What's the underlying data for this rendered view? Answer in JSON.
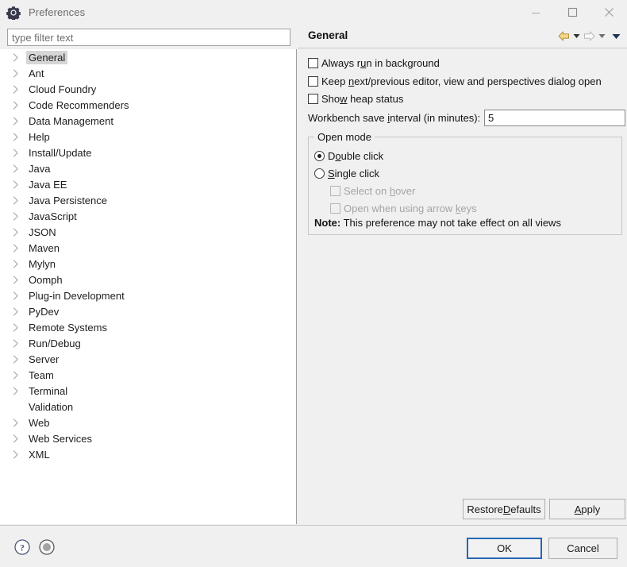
{
  "window": {
    "title": "Preferences",
    "icon": "gear-icon",
    "controls": {
      "minimize": "minimize-icon",
      "maximize": "maximize-icon",
      "close": "close-icon"
    }
  },
  "colors": {
    "dialog_bg": "#f0f0f0",
    "tree_bg": "#ffffff",
    "selection_bg": "#d6d6d6",
    "focus_border": "#2667b5",
    "back_arrow": "#ecc766",
    "help_icon": "#4a5a78"
  },
  "filter": {
    "value": "",
    "placeholder": "type filter text"
  },
  "tree": {
    "selected": "General",
    "items": [
      {
        "label": "General",
        "expandable": true,
        "selected": true
      },
      {
        "label": "Ant",
        "expandable": true,
        "selected": false
      },
      {
        "label": "Cloud Foundry",
        "expandable": true,
        "selected": false
      },
      {
        "label": "Code Recommenders",
        "expandable": true,
        "selected": false
      },
      {
        "label": "Data Management",
        "expandable": true,
        "selected": false
      },
      {
        "label": "Help",
        "expandable": true,
        "selected": false
      },
      {
        "label": "Install/Update",
        "expandable": true,
        "selected": false
      },
      {
        "label": "Java",
        "expandable": true,
        "selected": false
      },
      {
        "label": "Java EE",
        "expandable": true,
        "selected": false
      },
      {
        "label": "Java Persistence",
        "expandable": true,
        "selected": false
      },
      {
        "label": "JavaScript",
        "expandable": true,
        "selected": false
      },
      {
        "label": "JSON",
        "expandable": true,
        "selected": false
      },
      {
        "label": "Maven",
        "expandable": true,
        "selected": false
      },
      {
        "label": "Mylyn",
        "expandable": true,
        "selected": false
      },
      {
        "label": "Oomph",
        "expandable": true,
        "selected": false
      },
      {
        "label": "Plug-in Development",
        "expandable": true,
        "selected": false
      },
      {
        "label": "PyDev",
        "expandable": true,
        "selected": false
      },
      {
        "label": "Remote Systems",
        "expandable": true,
        "selected": false
      },
      {
        "label": "Run/Debug",
        "expandable": true,
        "selected": false
      },
      {
        "label": "Server",
        "expandable": true,
        "selected": false
      },
      {
        "label": "Team",
        "expandable": true,
        "selected": false
      },
      {
        "label": "Terminal",
        "expandable": true,
        "selected": false
      },
      {
        "label": "Validation",
        "expandable": false,
        "selected": false
      },
      {
        "label": "Web",
        "expandable": true,
        "selected": false
      },
      {
        "label": "Web Services",
        "expandable": true,
        "selected": false
      },
      {
        "label": "XML",
        "expandable": true,
        "selected": false
      }
    ]
  },
  "page": {
    "title": "General",
    "nav": {
      "back_icon": "back-arrow-icon",
      "back_menu_icon": "chevron-down-icon",
      "forward_icon": "forward-arrow-icon",
      "forward_menu_icon": "chevron-down-icon",
      "view_menu_icon": "chevron-down-icon"
    },
    "checkboxes": [
      {
        "label": "Always run in background",
        "checked": false,
        "enabled": true
      },
      {
        "label": "Keep next/previous editor, view and perspectives dialog open",
        "checked": false,
        "enabled": true
      },
      {
        "label": "Show heap status",
        "checked": false,
        "enabled": true
      }
    ],
    "save_interval": {
      "label": "Workbench save interval (in minutes):",
      "value": "5"
    },
    "open_mode": {
      "legend": "Open mode",
      "radios": [
        {
          "label": "Double click",
          "checked": true
        },
        {
          "label": "Single click",
          "checked": false
        }
      ],
      "sub_checkboxes": [
        {
          "label": "Select on hover",
          "checked": false,
          "enabled": false
        },
        {
          "label": "Open when using arrow keys",
          "checked": false,
          "enabled": false
        }
      ],
      "note_prefix": "Note:",
      "note_text": "This preference may not take effect on all views"
    },
    "buttons": {
      "restore_defaults": "Restore Defaults",
      "apply": "Apply"
    }
  },
  "footer": {
    "help_icon": "help-question-icon",
    "record_icon": "record-circle-icon",
    "ok": "OK",
    "cancel": "Cancel"
  }
}
